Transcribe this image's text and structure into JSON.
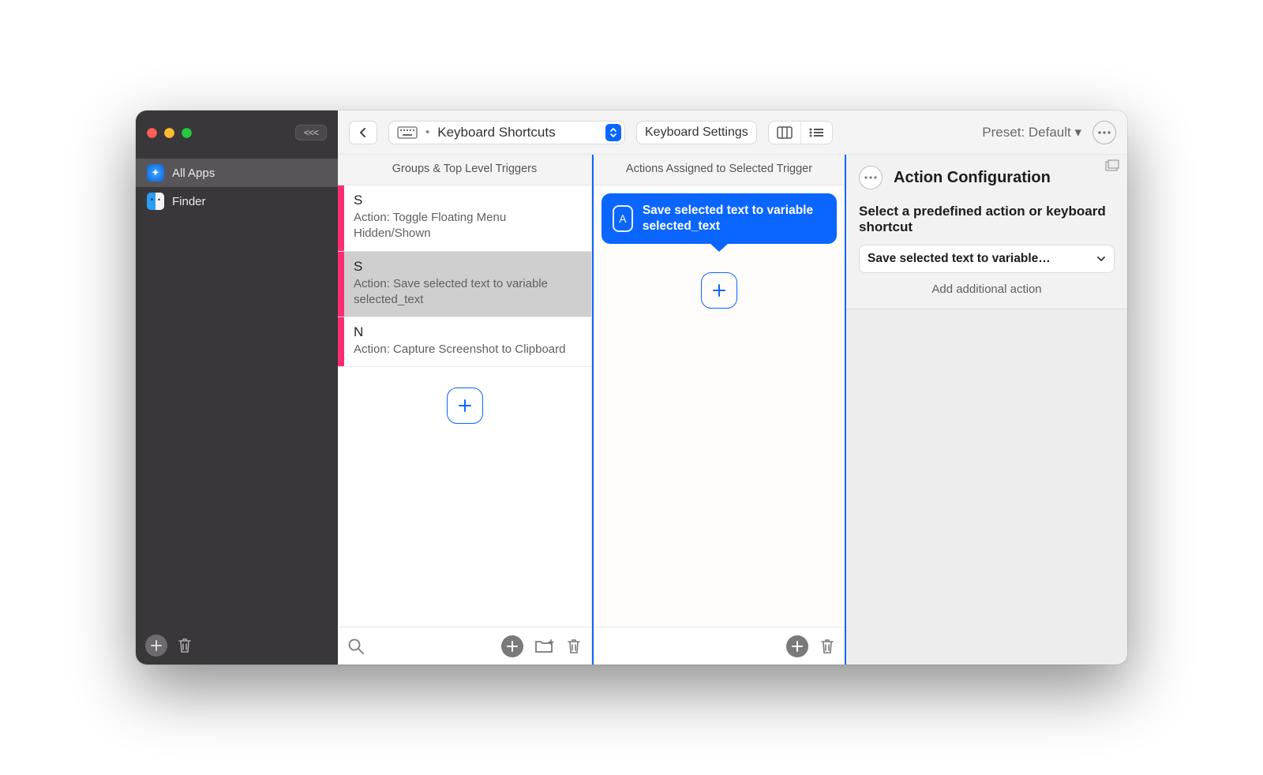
{
  "toolbar": {
    "collapse_label": "<<<",
    "dropdown_title": "Keyboard Shortcuts",
    "settings_button": "Keyboard Settings",
    "preset_label": "Preset: Default ▾"
  },
  "sidebar": {
    "items": [
      {
        "label": "All Apps",
        "selected": true
      },
      {
        "label": "Finder",
        "selected": false
      }
    ]
  },
  "triggers": {
    "column_title": "Groups & Top Level Triggers",
    "items": [
      {
        "key": "S",
        "sub": "Action: Toggle Floating Menu Hidden/Shown",
        "selected": false
      },
      {
        "key": "S",
        "sub": "Action: Save selected text to variable selected_text",
        "selected": true
      },
      {
        "key": "N",
        "sub": "Action: Capture Screenshot to Clipboard",
        "selected": false
      }
    ]
  },
  "actions": {
    "column_title": "Actions Assigned to Selected Trigger",
    "card_label": "Save selected text to variable selected_text"
  },
  "config": {
    "title": "Action Configuration",
    "subtitle": "Select a predefined action or keyboard shortcut",
    "selected_action": "Save selected text to variable…",
    "add_additional": "Add additional action"
  }
}
